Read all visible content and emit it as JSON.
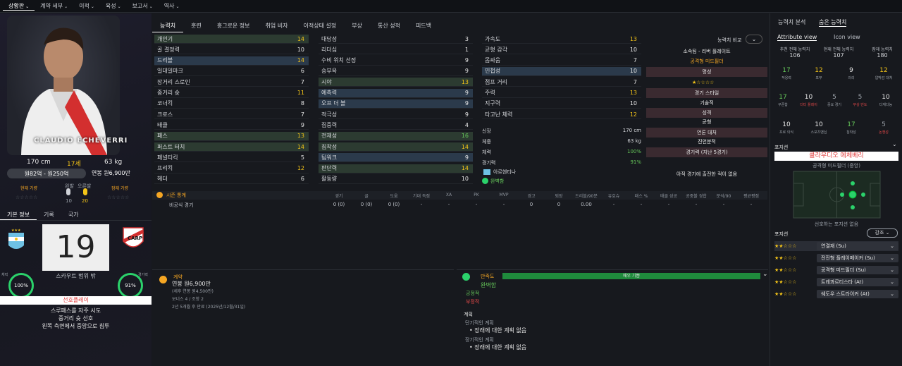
{
  "menu": [
    {
      "label": "상황판",
      "active": true
    },
    {
      "label": "계약 세부",
      "active": false
    },
    {
      "label": "이적",
      "active": false
    },
    {
      "label": "육성",
      "active": false
    },
    {
      "label": "보고서",
      "active": false
    },
    {
      "label": "역사",
      "active": false
    }
  ],
  "player": {
    "name_plate": "CLAUDIO ECHEVERRI",
    "height": "170 cm",
    "age": "17세",
    "weight": "63 kg",
    "value_range": "원82억 - 원250억",
    "wage_top": "연봉 원6,900만",
    "current_ability_label": "현재 가량",
    "potential_label": "잠재 가량",
    "foot_left_label": "왼발",
    "foot_right_label": "오른발",
    "foot_left_val": "10",
    "foot_right_val": "20",
    "squad_number": "19",
    "scout_label": "스카우트 범위 밖",
    "fitness_pct": "100%",
    "fitness_label": "체력",
    "condition_pct": "91%",
    "condition_label": "경기력",
    "playstyle_title": "선호플레이",
    "playstyle": [
      "스루패스를 자주 시도",
      "중거리 슛 선호",
      "왼쪽 측면에서 중앙으로 침투"
    ]
  },
  "left_tabs": [
    "기본 정보",
    "기록",
    "국가"
  ],
  "center_tabs": [
    {
      "label": "능력치",
      "active": true
    },
    {
      "label": "훈련",
      "active": false
    },
    {
      "label": "흥그로운 정보",
      "active": false
    },
    {
      "label": "취업 비자",
      "active": false
    },
    {
      "label": "이적상태 설정",
      "active": false
    },
    {
      "label": "부상",
      "active": false
    },
    {
      "label": "통산 성적",
      "active": false
    },
    {
      "label": "피드백",
      "active": false
    }
  ],
  "technical": [
    {
      "name": "개인기",
      "val": "14",
      "hl": "g",
      "c": "y"
    },
    {
      "name": "골 결정력",
      "val": "10",
      "hl": "",
      "c": "n"
    },
    {
      "name": "드리블",
      "val": "14",
      "hl": "b",
      "c": "y"
    },
    {
      "name": "일대일마크",
      "val": "6",
      "hl": "",
      "c": "n"
    },
    {
      "name": "장거리 스로인",
      "val": "7",
      "hl": "",
      "c": "n"
    },
    {
      "name": "중거리 슛",
      "val": "11",
      "hl": "",
      "c": "y"
    },
    {
      "name": "코너킥",
      "val": "8",
      "hl": "",
      "c": "n"
    },
    {
      "name": "크로스",
      "val": "7",
      "hl": "",
      "c": "n"
    },
    {
      "name": "태클",
      "val": "9",
      "hl": "",
      "c": "n"
    },
    {
      "name": "패스",
      "val": "13",
      "hl": "g",
      "c": "y"
    },
    {
      "name": "퍼스트 터치",
      "val": "14",
      "hl": "g",
      "c": "y"
    },
    {
      "name": "페널티킥",
      "val": "5",
      "hl": "",
      "c": "n"
    },
    {
      "name": "프리킥",
      "val": "12",
      "hl": "",
      "c": "y"
    },
    {
      "name": "헤더",
      "val": "6",
      "hl": "",
      "c": "n"
    }
  ],
  "mental": [
    {
      "name": "대담성",
      "val": "3",
      "hl": "",
      "c": "n"
    },
    {
      "name": "리더십",
      "val": "1",
      "hl": "",
      "c": "n"
    },
    {
      "name": "수비 위치 선정",
      "val": "9",
      "hl": "",
      "c": "n"
    },
    {
      "name": "승부욕",
      "val": "9",
      "hl": "",
      "c": "n"
    },
    {
      "name": "시야",
      "val": "13",
      "hl": "g",
      "c": "y"
    },
    {
      "name": "예측력",
      "val": "9",
      "hl": "b",
      "c": "n"
    },
    {
      "name": "오프 더 볼",
      "val": "9",
      "hl": "b",
      "c": "n"
    },
    {
      "name": "적극성",
      "val": "9",
      "hl": "",
      "c": "n"
    },
    {
      "name": "집중력",
      "val": "4",
      "hl": "",
      "c": "n"
    },
    {
      "name": "전재성",
      "val": "16",
      "hl": "g",
      "c": "g"
    },
    {
      "name": "침착성",
      "val": "14",
      "hl": "g",
      "c": "y"
    },
    {
      "name": "팀워크",
      "val": "9",
      "hl": "b",
      "c": "n"
    },
    {
      "name": "판단력",
      "val": "14",
      "hl": "g",
      "c": "y"
    },
    {
      "name": "활동량",
      "val": "10",
      "hl": "",
      "c": "n"
    }
  ],
  "physical": [
    {
      "name": "가속도",
      "val": "13",
      "hl": "",
      "c": "y"
    },
    {
      "name": "균형 감각",
      "val": "10",
      "hl": "",
      "c": "n"
    },
    {
      "name": "몸싸움",
      "val": "7",
      "hl": "",
      "c": "n"
    },
    {
      "name": "민첩성",
      "val": "10",
      "hl": "b",
      "c": "n"
    },
    {
      "name": "점프 거리",
      "val": "7",
      "hl": "",
      "c": "n"
    },
    {
      "name": "주력",
      "val": "13",
      "hl": "",
      "c": "y"
    },
    {
      "name": "지구력",
      "val": "10",
      "hl": "",
      "c": "n"
    },
    {
      "name": "타고난 체력",
      "val": "12",
      "hl": "",
      "c": "y"
    }
  ],
  "body": [
    {
      "k": "신장",
      "v": "170 cm",
      "c": ""
    },
    {
      "k": "체중",
      "v": "63 kg",
      "c": ""
    },
    {
      "k": "체력",
      "v": "100%",
      "c": "g"
    },
    {
      "k": "경기력",
      "v": "91%",
      "c": "g"
    }
  ],
  "intl_label": "아르헨티나",
  "fitness_status": "완벽함",
  "compare": {
    "button": "능력치 비교",
    "club": "소속팀 - 리버 플레이트",
    "role": "공격형 미드필더",
    "reputation_label": "명성",
    "match_style": "경기 스타일",
    "technique": "기술적",
    "personality_label": "성격",
    "personality": "균형",
    "media_label": "언론 대처",
    "media": "진언분적",
    "form_label": "경기력 (지난 5경기)",
    "no_games": "아직 경기에 출전한 적이 없음"
  },
  "season": {
    "title": "시즌 통계",
    "headers": [
      "경기",
      "골",
      "도움",
      "기대 득점",
      "XA",
      "PK",
      "MVP",
      "경고",
      "퇴장",
      "드리블/90분",
      "유효슈",
      "패스 %",
      "태클 성공",
      "공중볼 경합",
      "분석/90",
      "평균평점"
    ],
    "row_label": "비공식 경기",
    "row": [
      "0 (0)",
      "0 (0)",
      "0 (0)",
      "-",
      "-",
      "-",
      "-",
      "0",
      "0",
      "0.00",
      "-",
      "-",
      "-",
      "-",
      "-",
      "-"
    ]
  },
  "contract": {
    "title": "계약",
    "wage": "연봉 원6,900만",
    "wage_sub": "(세후 연봉 원4,500만)",
    "bonus": "보너스 4 / 조항 2",
    "end": "2년 5개월 후 만료 (2025년/12월/31일)"
  },
  "prospect": {
    "title": "만족도",
    "bar_label": "매우 기쁨",
    "status": "완벽함",
    "positive": "긍정적",
    "negative": "부정적",
    "plan_title": "계획",
    "short_label": "단기적인 계획",
    "short_item": "장래에 대한 계획 없음",
    "long_label": "장기적인 계획",
    "long_item": "장래에 대한 계획 없음"
  },
  "right": {
    "tabs": [
      "능력치 분석",
      "숨은 능력치"
    ],
    "views": [
      "Attribute view",
      "Icon view"
    ],
    "totals": [
      {
        "label": "추천 전체 능력치",
        "val": "106"
      },
      {
        "label": "현재 전체 능력치",
        "val": "107"
      },
      {
        "label": "잠재 능력치",
        "val": "180"
      }
    ],
    "hidden_row1": [
      {
        "v": "17",
        "l": "적응력",
        "c": "#66c85a"
      },
      {
        "v": "12",
        "l": "포부",
        "c": "#f5c518"
      },
      {
        "v": "9",
        "l": "의리",
        "c": "#e6e6e6"
      },
      {
        "v": "12",
        "l": "압박감 대처",
        "c": "#f5c518"
      }
    ],
    "hidden_row2": [
      {
        "v": "17",
        "l": "꾸준함",
        "c": "#66c85a"
      },
      {
        "v": "10",
        "l": "더티 플레이",
        "c": "#e6e6e6",
        "lc": "#e04848"
      },
      {
        "v": "5",
        "l": "중요 경기",
        "c": "#9aa0a8"
      },
      {
        "v": "5",
        "l": "부상 빈도",
        "c": "#9aa0a8",
        "lc": "#e04848"
      },
      {
        "v": "10",
        "l": "다재다능",
        "c": "#e6e6e6"
      }
    ],
    "hidden_row3": [
      {
        "v": "10",
        "l": "프로 의식",
        "c": "#e6e6e6"
      },
      {
        "v": "10",
        "l": "스포츠맨십",
        "c": "#e6e6e6"
      },
      {
        "v": "17",
        "l": "침착성",
        "c": "#66c85a"
      },
      {
        "v": "5",
        "l": "논쟁성",
        "c": "#9aa0a8",
        "lc": "#e04848"
      }
    ],
    "position_title": "포지션",
    "position_name": "클라우디오 에체베리",
    "position_role": "공격형 미드필더 (중앙)",
    "position_caption": "선호하는 포지션 없음",
    "roles_title": "포지션",
    "roles_filter": "강조",
    "roles": [
      {
        "stars": "★★☆☆☆",
        "name": "연결재 (Su)"
      },
      {
        "stars": "★★☆☆☆",
        "name": "전진형 플레이메이커 (Su)"
      },
      {
        "stars": "★★☆☆☆",
        "name": "공격형 미드필더 (Su)"
      },
      {
        "stars": "★★☆☆☆",
        "name": "트레콰르티스타 (At)"
      },
      {
        "stars": "★★☆☆☆",
        "name": "쉐도우 스트라이커 (At)"
      }
    ]
  }
}
